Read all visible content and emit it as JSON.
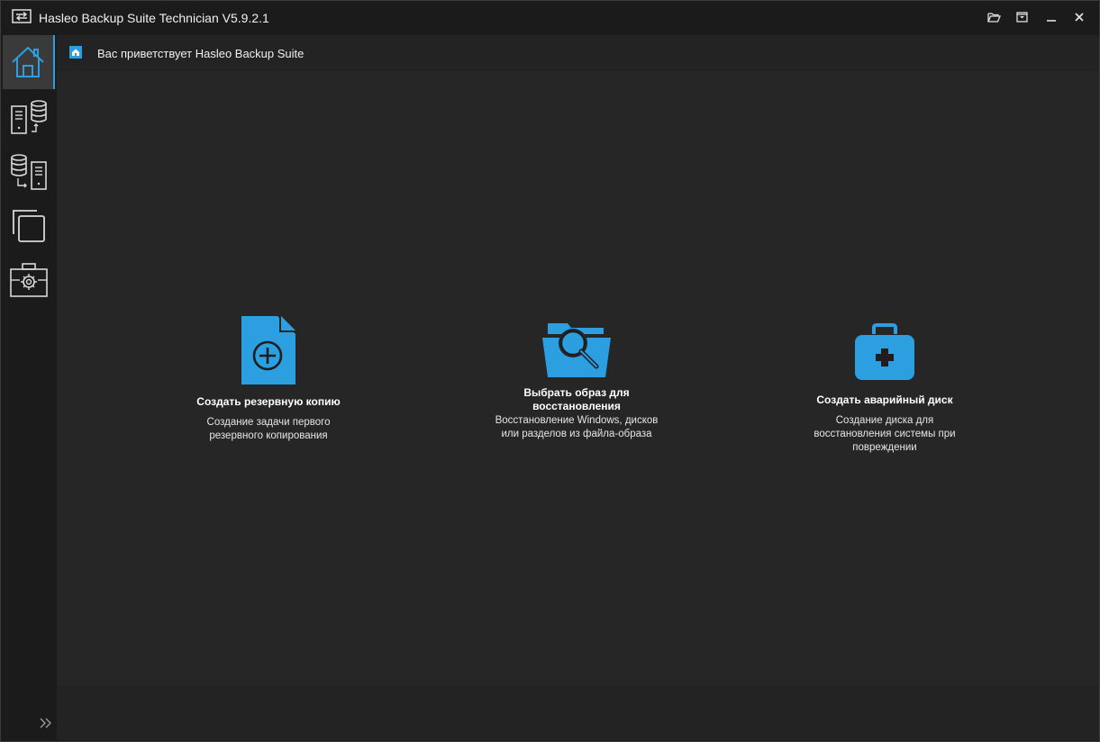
{
  "window": {
    "title": "Hasleo Backup Suite Technician V5.9.2.1"
  },
  "titlebar_buttons": [
    "folder-open-icon",
    "menu-icon",
    "minimize-icon",
    "close-icon"
  ],
  "sidebar": {
    "items": [
      {
        "name": "home",
        "icon": "home-icon",
        "active": true
      },
      {
        "name": "backup",
        "icon": "backup-icon",
        "active": false
      },
      {
        "name": "restore",
        "icon": "restore-icon",
        "active": false
      },
      {
        "name": "clone",
        "icon": "clone-icon",
        "active": false
      },
      {
        "name": "tools",
        "icon": "tools-icon",
        "active": false
      }
    ]
  },
  "header": {
    "title": "Вас приветствует Hasleo Backup Suite"
  },
  "cards": [
    {
      "title": "Создать резервную копию",
      "desc_line1": "Создание задачи первого",
      "desc_line2": "резервного копирования",
      "icon": "new-backup-icon"
    },
    {
      "title_line1": "Выбрать образ для",
      "title_line2": "восстановления",
      "desc_line1": "Восстановление Windows, дисков",
      "desc_line2": "или разделов из файла-образа",
      "icon": "browse-image-icon"
    },
    {
      "title": "Создать аварийный диск",
      "desc_line1": "Создание диска для",
      "desc_line2": "восстановления системы при",
      "desc_line3": "повреждении",
      "icon": "emergency-disk-icon"
    }
  ],
  "colors": {
    "accent": "#2b9fe0",
    "background": "#1b1b1b",
    "content": "#262626"
  }
}
